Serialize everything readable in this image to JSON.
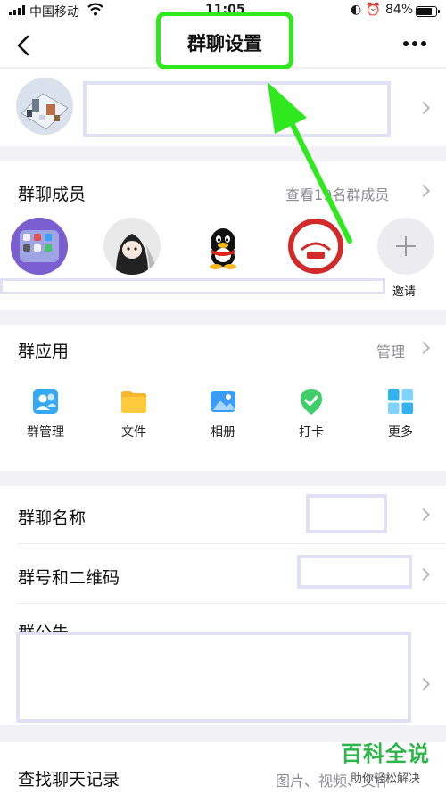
{
  "status_bar": {
    "carrier": "中国移动",
    "time": "11:05",
    "battery_percent": "84%",
    "battery_level": 0.84
  },
  "nav": {
    "title": "群聊设置",
    "back_icon": "chevron-left-icon",
    "more_icon": "more-dots-icon"
  },
  "members": {
    "title": "群聊成员",
    "view_all": "查看19名群成员",
    "invite_label": "邀请"
  },
  "apps": {
    "title": "群应用",
    "manage": "管理",
    "items": [
      {
        "label": "群管理",
        "icon": "group-manage-icon",
        "color": "#36a9f5"
      },
      {
        "label": "文件",
        "icon": "folder-icon",
        "color": "#f8b62d"
      },
      {
        "label": "相册",
        "icon": "album-icon",
        "color": "#3b9cf3"
      },
      {
        "label": "打卡",
        "icon": "check-in-icon",
        "color": "#3ecf6a"
      },
      {
        "label": "更多",
        "icon": "grid-more-icon",
        "color": "#30b3f0"
      }
    ]
  },
  "settings": {
    "name_label": "群聊名称",
    "number_label": "群号和二维码",
    "notice_label": "群公告"
  },
  "history": {
    "title": "查找聊天记录",
    "extra": "图片、视频、文件"
  },
  "watermark": {
    "main": "百科全说",
    "sub": "助你轻松解决"
  },
  "colors": {
    "highlight": "#2fe81d",
    "redaction": "#e1e1f5"
  }
}
